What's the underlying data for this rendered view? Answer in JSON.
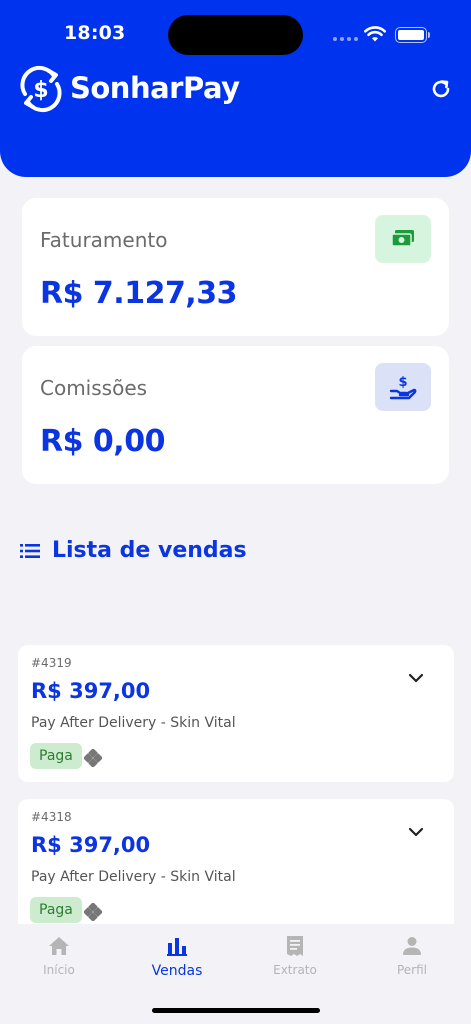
{
  "status_bar": {
    "time": "18:03"
  },
  "brand": {
    "name": "SonharPay",
    "primary_color": "#0033ee",
    "accent_color": "#0a35e0"
  },
  "header": {
    "logo_icon": "dollar-cycle-icon",
    "refresh_icon": "refresh-icon"
  },
  "cards": [
    {
      "label": "Faturamento",
      "value": "R$ 7.127,33",
      "icon": "cash-icon"
    },
    {
      "label": "Comissões",
      "value": "R$ 0,00",
      "icon": "hand-dollar-icon"
    }
  ],
  "sales_section": {
    "title": "Lista de vendas",
    "icon": "list-icon"
  },
  "sales": [
    {
      "id": "#4319",
      "amount": "R$ 397,00",
      "description": "Pay After Delivery - Skin Vital",
      "status": "Paga",
      "method_icon": "pix-icon"
    },
    {
      "id": "#4318",
      "amount": "R$ 397,00",
      "description": "Pay After Delivery - Skin Vital",
      "status": "Paga",
      "method_icon": "pix-icon"
    }
  ],
  "tabs": [
    {
      "label": "Início",
      "icon": "home-icon",
      "active": false
    },
    {
      "label": "Vendas",
      "icon": "bar-chart-icon",
      "active": true
    },
    {
      "label": "Extrato",
      "icon": "receipt-icon",
      "active": false
    },
    {
      "label": "Perfil",
      "icon": "user-icon",
      "active": false
    }
  ]
}
